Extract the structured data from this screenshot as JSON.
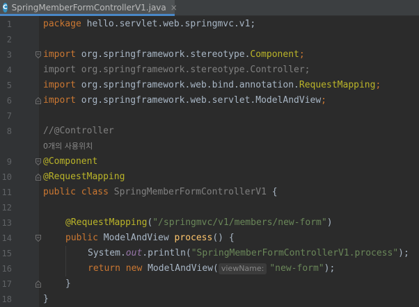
{
  "tab": {
    "icon": "C",
    "title": "SpringMemberFormControllerV1.java",
    "close": "×"
  },
  "lines": [
    {
      "n": "1",
      "t": "package hello.servlet.web.springmvc.v1;"
    },
    {
      "n": "2",
      "t": ""
    },
    {
      "n": "3",
      "t": "import org.springframework.stereotype.Component;"
    },
    {
      "n": "4",
      "t": "import org.springframework.stereotype.Controller;"
    },
    {
      "n": "5",
      "t": "import org.springframework.web.bind.annotation.RequestMapping;"
    },
    {
      "n": "6",
      "t": "import org.springframework.web.servlet.ModelAndView;"
    },
    {
      "n": "7",
      "t": ""
    },
    {
      "n": "8",
      "t": "//@Controller"
    },
    {
      "n": "",
      "t": "0개의 사용위치"
    },
    {
      "n": "9",
      "t": "@Component"
    },
    {
      "n": "10",
      "t": "@RequestMapping"
    },
    {
      "n": "11",
      "t": "public class SpringMemberFormControllerV1 {"
    },
    {
      "n": "12",
      "t": ""
    },
    {
      "n": "13",
      "t": "@RequestMapping(\"/springmvc/v1/members/new-form\")"
    },
    {
      "n": "14",
      "t": "public ModelAndView process() {"
    },
    {
      "n": "15",
      "t": "System.out.println(\"SpringMemberFormControllerV1.process\");"
    },
    {
      "n": "16",
      "t": "return new ModelAndView( viewName: \"new-form\");"
    },
    {
      "n": "17",
      "t": "}"
    },
    {
      "n": "18",
      "t": "}"
    }
  ],
  "code": {
    "l1": {
      "kw": "package",
      "rest": " hello.servlet.web.springmvc.v1;"
    },
    "l3": {
      "kw": "import",
      "pkg": " org.springframework.stereotype.",
      "cls": "Component",
      "end": ";"
    },
    "l4": {
      "text": "import org.springframework.stereotype.Controller;"
    },
    "l5": {
      "kw": "import",
      "pkg": " org.springframework.web.bind.annotation.",
      "cls": "RequestMapping",
      "end": ";"
    },
    "l6": {
      "kw": "import",
      "pkg": " org.springframework.web.servlet.ModelAndView",
      "end": ";"
    },
    "l8": {
      "text": "//@Controller"
    },
    "usage": "0개의 사용위치",
    "l9": {
      "ann": "@Component"
    },
    "l10": {
      "ann": "@RequestMapping"
    },
    "l11": {
      "kw": "public class",
      "cls": " SpringMemberFormControllerV1",
      "end": " {"
    },
    "l13": {
      "ann": "@RequestMapping",
      "open": "(",
      "str": "\"/springmvc/v1/members/new-form\"",
      "close": ")"
    },
    "l14": {
      "kw": "public",
      "type": " ModelAndView ",
      "fn": "process",
      "end": "() {"
    },
    "l15": {
      "a": "System.",
      "fld": "out",
      "b": ".println(",
      "str": "\"SpringMemberFormControllerV1.process\"",
      "end": ");"
    },
    "l16": {
      "kw": "return new",
      "type": " ModelAndView(",
      "hint": "viewName:",
      "str": "\"new-form\"",
      "end": ");"
    },
    "l17": {
      "text": "}"
    },
    "l18": {
      "text": "}"
    }
  },
  "colors": {
    "background": "#2b2b2b",
    "keyword": "#cc7832",
    "annotation": "#bbb529",
    "string": "#6a8759",
    "comment": "#808080",
    "field": "#9876aa",
    "method": "#ffc66d",
    "text": "#a9b7c6"
  }
}
